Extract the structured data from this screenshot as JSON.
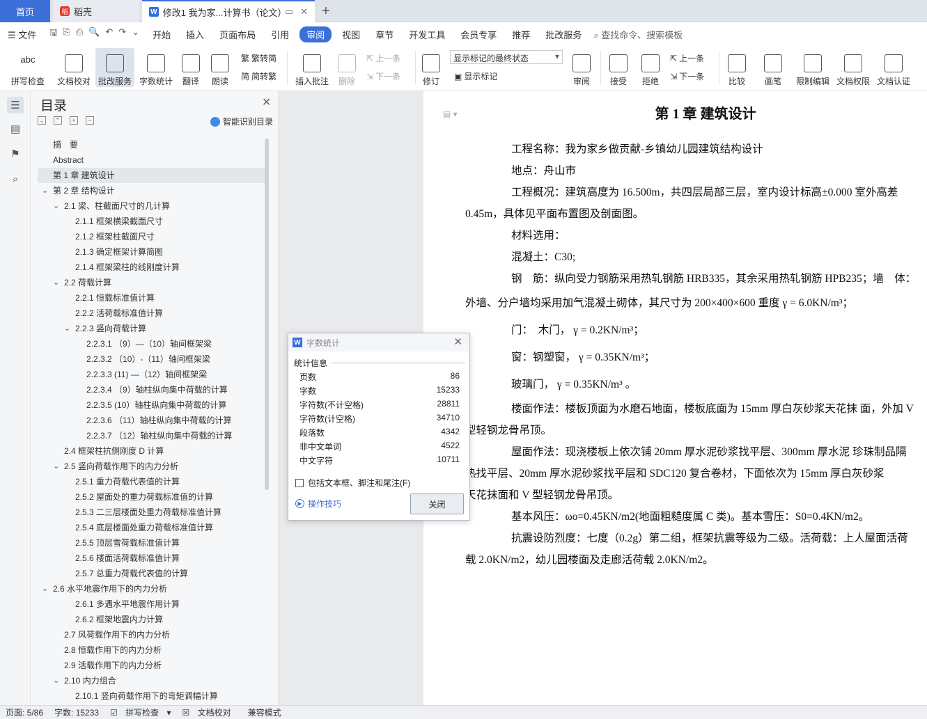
{
  "tabs": {
    "home": "首页",
    "daoke": "稻壳",
    "doc": "修改1 我为家...计算书（论文）"
  },
  "menu": {
    "file": "文件",
    "items": [
      "开始",
      "插入",
      "页面布局",
      "引用",
      "审阅",
      "视图",
      "章节",
      "开发工具",
      "会员专享",
      "推荐",
      "批改服务"
    ],
    "active": "审阅",
    "search": "查找命令、搜索模板"
  },
  "ribbon": {
    "spell": "拼写检查",
    "proof": "文档校对",
    "correct": "批改服务",
    "wordcount": "字数统计",
    "translate": "翻译",
    "read": "朗读",
    "trad": "繁转简",
    "simp": "简转繁",
    "insert_comment": "插入批注",
    "delete": "删除",
    "prev": "上一条",
    "next": "下一条",
    "revise": "修订",
    "markstate": "显示标记的最终状态",
    "showmark": "显示标记",
    "review": "审阅",
    "accept": "接受",
    "reject": "拒绝",
    "prev2": "上一条",
    "next2": "下一条",
    "compare": "比较",
    "pen": "画笔",
    "restrict": "限制编辑",
    "perm": "文档权限",
    "cert": "文档认证"
  },
  "toc": {
    "title": "目录",
    "ai": "智能识别目录",
    "items": [
      {
        "label": "摘　要",
        "level": 0,
        "arrow": ""
      },
      {
        "label": "Abstract",
        "level": 0,
        "arrow": ""
      },
      {
        "label": "第 1 章  建筑设计",
        "level": 0,
        "arrow": "",
        "selected": true
      },
      {
        "label": "第 2 章  结构设计",
        "level": 0,
        "arrow": "v"
      },
      {
        "label": "2.1 梁、柱截面尺寸的几计算",
        "level": 1,
        "arrow": "v"
      },
      {
        "label": "2.1.1  框架横梁截面尺寸",
        "level": 2,
        "arrow": ""
      },
      {
        "label": "2.1.2  框架柱截面尺寸",
        "level": 2,
        "arrow": ""
      },
      {
        "label": "2.1.3  确定框架计算简图",
        "level": 2,
        "arrow": ""
      },
      {
        "label": "2.1.4  框架梁柱的线刚度计算",
        "level": 2,
        "arrow": ""
      },
      {
        "label": "2.2 荷载计算",
        "level": 1,
        "arrow": "v"
      },
      {
        "label": "2.2.1  恒载标准值计算",
        "level": 2,
        "arrow": ""
      },
      {
        "label": "2.2.2  活荷载标准值计算",
        "level": 2,
        "arrow": ""
      },
      {
        "label": "2.2.3  竖向荷载计算",
        "level": 2,
        "arrow": "v"
      },
      {
        "label": "2.2.3.1  （9）—（10）轴间框架梁",
        "level": 3,
        "arrow": ""
      },
      {
        "label": "2.2.3.2  （10）-（11）轴间框架梁",
        "level": 3,
        "arrow": ""
      },
      {
        "label": "2.2.3.3  (11) —（12）轴间框架梁",
        "level": 3,
        "arrow": ""
      },
      {
        "label": "2.2.3.4  （9）轴柱纵向集中荷载的计算",
        "level": 3,
        "arrow": ""
      },
      {
        "label": "2.2.3.5  (10）轴柱纵向集中荷载的计算",
        "level": 3,
        "arrow": ""
      },
      {
        "label": "2.2.3.6  （11）轴柱纵向集中荷载的计算",
        "level": 3,
        "arrow": ""
      },
      {
        "label": "2.2.3.7  （12）轴柱纵向集中荷载的计算",
        "level": 3,
        "arrow": ""
      },
      {
        "label": "2.4  框架柱抗侧刚度 D 计算",
        "level": 1,
        "arrow": ""
      },
      {
        "label": "2.5  竖向荷载作用下的内力分析",
        "level": 1,
        "arrow": "v"
      },
      {
        "label": "2.5.1  重力荷载代表值的计算",
        "level": 2,
        "arrow": ""
      },
      {
        "label": "2.5.2  屋面处的重力荷载标准值的计算",
        "level": 2,
        "arrow": ""
      },
      {
        "label": "2.5.3  二三层楼面处重力荷载标准值计算",
        "level": 2,
        "arrow": ""
      },
      {
        "label": "2.5.4 底层楼面处重力荷载标准值计算",
        "level": 2,
        "arrow": ""
      },
      {
        "label": "2.5.5 顶层雪荷载标准值计算",
        "level": 2,
        "arrow": ""
      },
      {
        "label": "2.5.6 楼面活荷载标准值计算",
        "level": 2,
        "arrow": ""
      },
      {
        "label": "2.5.7 总重力荷载代表值的计算",
        "level": 2,
        "arrow": ""
      },
      {
        "label": "2.6 水平地震作用下的内力分析",
        "level": 0,
        "arrow": "v"
      },
      {
        "label": "2.6.1  多遇水平地震作用计算",
        "level": 2,
        "arrow": ""
      },
      {
        "label": "2.6.2  框架地震内力计算",
        "level": 2,
        "arrow": ""
      },
      {
        "label": "2.7  风荷载作用下的内力分析",
        "level": 1,
        "arrow": ""
      },
      {
        "label": "2.8  恒载作用下的内力分析",
        "level": 1,
        "arrow": ""
      },
      {
        "label": "2.9  活载作用下的内力分析",
        "level": 1,
        "arrow": ""
      },
      {
        "label": "2.10  内力组合",
        "level": 1,
        "arrow": "v"
      },
      {
        "label": "2.10.1  竖向荷载作用下的弯矩调幅计算",
        "level": 2,
        "arrow": ""
      }
    ]
  },
  "doc": {
    "heading": "第 1 章  建筑设计",
    "paragraphs": [
      {
        "text": "工程名称：我为家乡做贡献-乡镇幼儿园建筑结构设计",
        "indent": true
      },
      {
        "text": "地点：舟山市",
        "indent": true
      },
      {
        "text": "工程概况：建筑高度为 16.500m，共四层局部三层，室内设计标高±0.000 室外高差",
        "indent": true
      },
      {
        "text": "0.45m，具体见平面布置图及剖面图。",
        "indent": false
      },
      {
        "text": "材料选用：",
        "indent": true
      },
      {
        "text": "混凝土：C30;",
        "indent": true
      },
      {
        "text": "钢　筋：纵向受力钢筋采用热轧钢筋 HRB335，其余采用热轧钢筋 HPB235；墙　体：",
        "indent": true
      },
      {
        "text": "外墙、分户墙均采用加气混凝土砌体，其尺寸为 200×400×600  重度  γ = 6.0KN/m³；",
        "indent": false,
        "tall": true
      },
      {
        "text": "门：　木门，  γ = 0.2KN/m³；",
        "indent": true,
        "tall": true
      },
      {
        "text": "窗：钢塑窗，  γ = 0.35KN/m³；",
        "indent": true,
        "tall": true
      },
      {
        "text": "玻璃门，  γ = 0.35KN/m³ 。",
        "indent": true,
        "tall": true
      },
      {
        "text": "楼面作法：楼板顶面为水磨石地面，楼板底面为 15mm 厚白灰砂浆天花抹  面，外加 V",
        "indent": true
      },
      {
        "text": "型轻钢龙骨吊顶。",
        "indent": false
      },
      {
        "text": "屋面作法：现浇楼板上依次铺 20mm 厚水泥砂浆找平层、300mm 厚水泥  珍珠制品隔",
        "indent": true
      },
      {
        "text": "热找平层、20mm 厚水泥砂浆找平层和 SDC120 复合卷材，下面依次为 15mm 厚白灰砂浆",
        "indent": false
      },
      {
        "text": "天花抹面和 V 型轻钢龙骨吊顶。",
        "indent": false
      },
      {
        "text": "基本风压：ωo=0.45KN/m2(地面粗糙度属 C 类)。基本雪压：S0=0.4KN/m2。",
        "indent": true
      },
      {
        "text": "抗震设防烈度：七度（0.2g）第二组，框架抗震等级为二级。活荷载：上人屋面活荷",
        "indent": true
      },
      {
        "text": "载 2.0KN/m2，幼儿园楼面及走廊活荷载 2.0KN/m2。",
        "indent": false
      }
    ]
  },
  "dialog": {
    "title": "字数统计",
    "section": "统计信息",
    "rows": [
      {
        "label": "页数",
        "value": "86"
      },
      {
        "label": "字数",
        "value": "15233"
      },
      {
        "label": "字符数(不计空格)",
        "value": "28811"
      },
      {
        "label": "字符数(计空格)",
        "value": "34710"
      },
      {
        "label": "段落数",
        "value": "4342"
      },
      {
        "label": "非中文单词",
        "value": "4522"
      },
      {
        "label": "中文字符",
        "value": "10711"
      }
    ],
    "checkbox": "包括文本框、脚注和尾注(F)",
    "tips": "操作技巧",
    "close": "关闭"
  },
  "status": {
    "page": "页面: 5/86",
    "words": "字数: 15233",
    "spell": "拼写检查",
    "proof": "文档校对",
    "compat": "兼容模式"
  }
}
